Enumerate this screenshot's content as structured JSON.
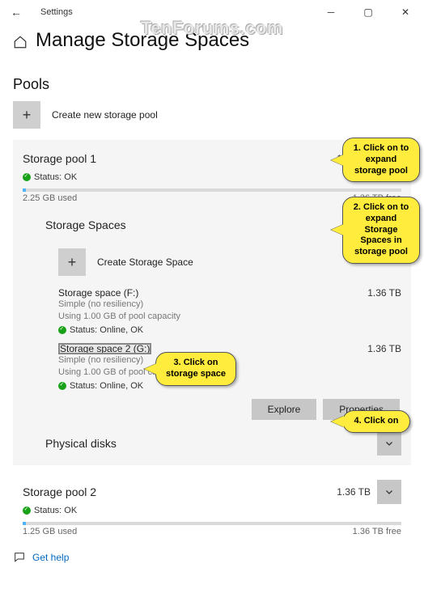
{
  "watermark": "TenForums.com",
  "window": {
    "title": "Settings"
  },
  "page": {
    "title": "Manage Storage Spaces"
  },
  "sections": {
    "pools": "Pools"
  },
  "create_pool": "Create new storage pool",
  "pool1": {
    "name": "Storage pool 1",
    "size": "1.36 TB",
    "status": "Status: OK",
    "used": "2.25 GB used",
    "free": "1.36 TB free",
    "spaces_header": "Storage Spaces",
    "create_space": "Create Storage Space",
    "space_f": {
      "name": "Storage space (F:)",
      "size": "1.36 TB",
      "resiliency": "Simple (no resiliency)",
      "capacity": "Using 1.00 GB of pool capacity",
      "status": "Status: Online, OK"
    },
    "space_g": {
      "name": "Storage space 2 (G:)",
      "size": "1.36 TB",
      "resiliency": "Simple (no resiliency)",
      "capacity": "Using 1.00 GB of pool capacity",
      "status": "Status: Online, OK"
    },
    "buttons": {
      "explore": "Explore",
      "properties": "Properties"
    },
    "physical_disks": "Physical disks"
  },
  "pool2": {
    "name": "Storage pool 2",
    "size": "1.36 TB",
    "status": "Status: OK",
    "used": "1.25 GB used",
    "free": "1.36 TB free"
  },
  "help": "Get help",
  "callouts": {
    "c1": "1. Click on to expand storage pool",
    "c2": "2. Click on to expand Storage Spaces in storage pool",
    "c3": "3. Click on storage space",
    "c4": "4. Click on"
  }
}
